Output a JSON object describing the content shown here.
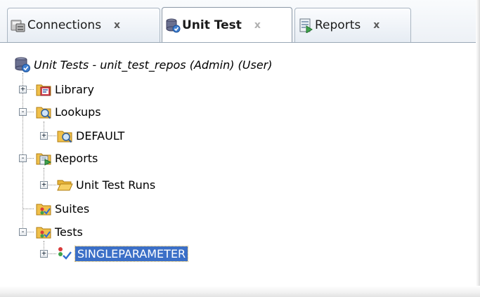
{
  "tabs": [
    {
      "label": "Connections",
      "close": "x",
      "icon": "connections-icon",
      "active": false
    },
    {
      "label": "Unit Test",
      "close": "x",
      "icon": "unit-test-icon",
      "active": true
    },
    {
      "label": "Reports",
      "close": "x",
      "icon": "reports-icon",
      "active": false
    }
  ],
  "tree": {
    "root": {
      "label": "Unit Tests - unit_test_repos (Admin) (User)",
      "icon": "database-icon"
    },
    "nodes": [
      {
        "label": "Library",
        "icon": "library-folder-icon",
        "expander": "+"
      },
      {
        "label": "Lookups",
        "icon": "lookups-folder-icon",
        "expander": "-"
      },
      {
        "label": "DEFAULT",
        "icon": "lookup-folder-icon",
        "expander": "+"
      },
      {
        "label": "Reports",
        "icon": "reports-folder-icon",
        "expander": "-"
      },
      {
        "label": "Unit Test Runs",
        "icon": "open-folder-icon",
        "expander": "+"
      },
      {
        "label": "Suites",
        "icon": "suites-folder-icon",
        "expander": ""
      },
      {
        "label": "Tests",
        "icon": "tests-folder-icon",
        "expander": "-"
      },
      {
        "label": "SINGLEPARAMETER",
        "icon": "test-item-icon",
        "expander": "+",
        "selected": true
      }
    ]
  },
  "colors": {
    "selection": "#3b6fc7",
    "tab_border": "#aab6c2"
  }
}
